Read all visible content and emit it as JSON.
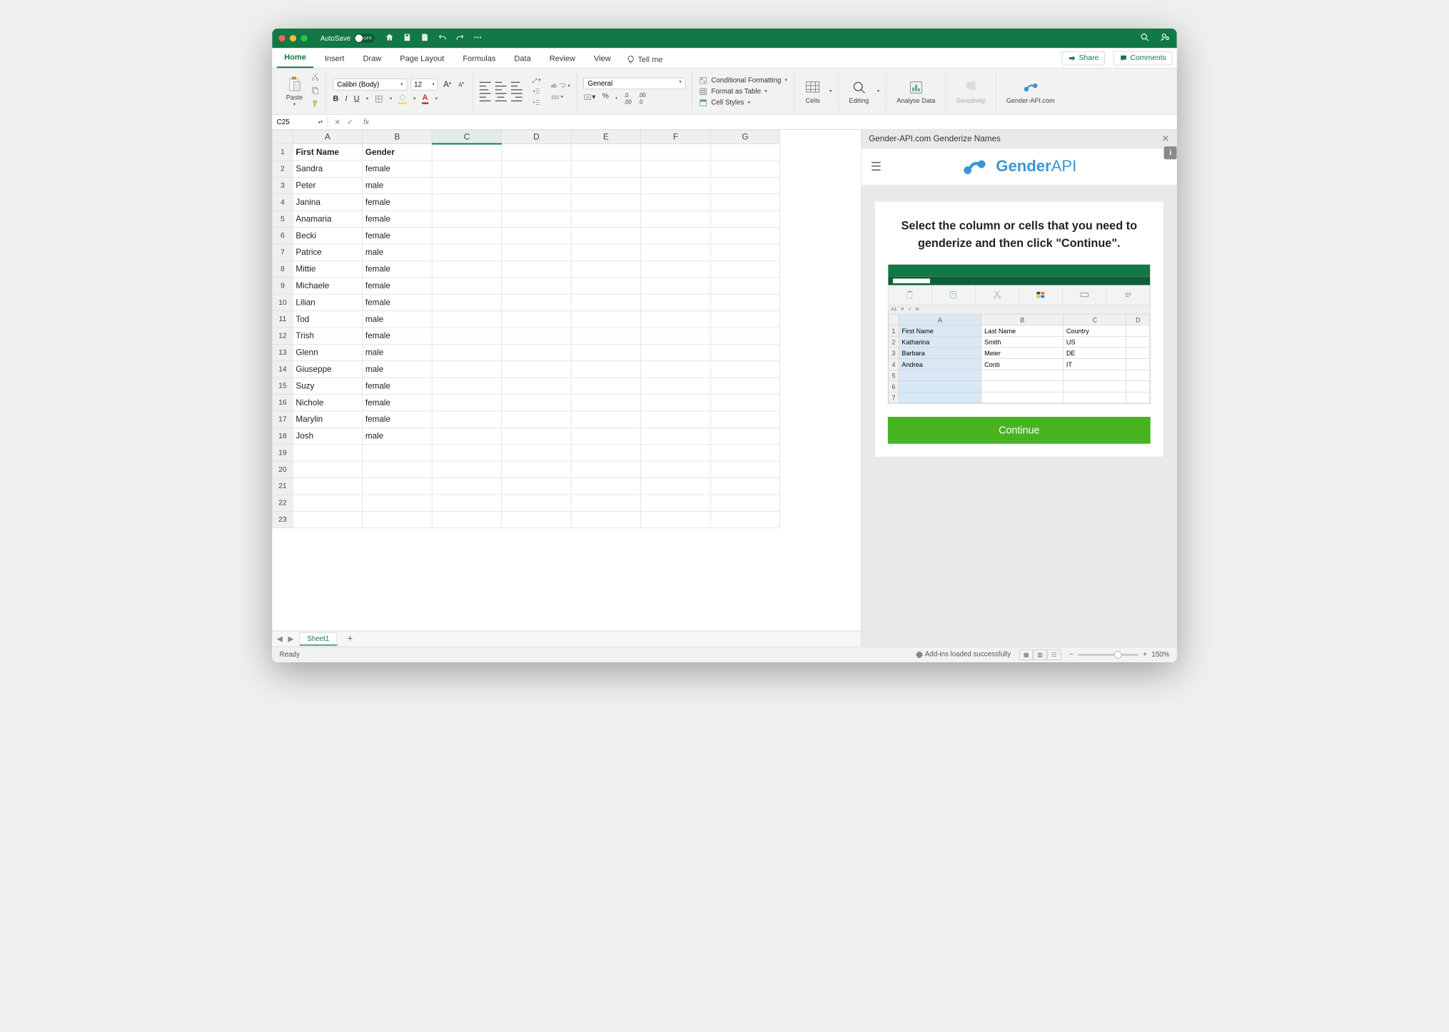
{
  "titlebar": {
    "autosave_label": "AutoSave",
    "autosave_state": "OFF"
  },
  "tabs": {
    "items": [
      "Home",
      "Insert",
      "Draw",
      "Page Layout",
      "Formulas",
      "Data",
      "Review",
      "View"
    ],
    "active": "Home",
    "tellme": "Tell me",
    "share": "Share",
    "comments": "Comments"
  },
  "ribbon": {
    "paste": "Paste",
    "font_name": "Calibri (Body)",
    "font_size": "12",
    "number_format": "General",
    "cond_fmt": "Conditional Formatting",
    "fmt_table": "Format as Table",
    "cell_styles": "Cell Styles",
    "cells": "Cells",
    "editing": "Editing",
    "analyse": "Analyse Data",
    "sensitivity": "Sensitivity",
    "genderapi": "Gender-API.com"
  },
  "formula_bar": {
    "name_box": "C25"
  },
  "sheet": {
    "columns": [
      "A",
      "B",
      "C",
      "D",
      "E",
      "F",
      "G"
    ],
    "selected_col": "C",
    "rows": [
      {
        "n": "1",
        "a": "First Name",
        "b": "Gender"
      },
      {
        "n": "2",
        "a": "Sandra",
        "b": "female"
      },
      {
        "n": "3",
        "a": "Peter",
        "b": "male"
      },
      {
        "n": "4",
        "a": "Janina",
        "b": "female"
      },
      {
        "n": "5",
        "a": "Anamaria",
        "b": "female"
      },
      {
        "n": "6",
        "a": "Becki",
        "b": "female"
      },
      {
        "n": "7",
        "a": "Patrice",
        "b": "male"
      },
      {
        "n": "8",
        "a": "Mittie",
        "b": "female"
      },
      {
        "n": "9",
        "a": "Michaele",
        "b": "female"
      },
      {
        "n": "10",
        "a": "Lilian",
        "b": "female"
      },
      {
        "n": "11",
        "a": "Tod",
        "b": "male"
      },
      {
        "n": "12",
        "a": "Trish",
        "b": "female"
      },
      {
        "n": "13",
        "a": "Glenn",
        "b": "male"
      },
      {
        "n": "14",
        "a": "Giuseppe",
        "b": "male"
      },
      {
        "n": "15",
        "a": "Suzy",
        "b": "female"
      },
      {
        "n": "16",
        "a": "Nichole",
        "b": "female"
      },
      {
        "n": "17",
        "a": "Marylin",
        "b": "female"
      },
      {
        "n": "18",
        "a": "Josh",
        "b": "male"
      },
      {
        "n": "19",
        "a": "",
        "b": ""
      },
      {
        "n": "20",
        "a": "",
        "b": ""
      },
      {
        "n": "21",
        "a": "",
        "b": ""
      },
      {
        "n": "22",
        "a": "",
        "b": ""
      },
      {
        "n": "23",
        "a": "",
        "b": ""
      }
    ],
    "tab_name": "Sheet1"
  },
  "pane": {
    "title": "Gender-API.com Genderize Names",
    "logo_bold": "Gender",
    "logo_light": "API",
    "heading": "Select the column or cells that you need to genderize and then click \"Continue\".",
    "mini_headers": [
      "First Name",
      "Last Name",
      "Country"
    ],
    "mini_cols": [
      "A",
      "B",
      "C",
      "D"
    ],
    "mini_rows": [
      {
        "n": "1",
        "a": "First Name",
        "b": "Last Name",
        "c": "Country"
      },
      {
        "n": "2",
        "a": "Katharina",
        "b": "Smith",
        "c": "US"
      },
      {
        "n": "3",
        "a": "Barbara",
        "b": "Meier",
        "c": "DE"
      },
      {
        "n": "4",
        "a": "Andrea",
        "b": "Conti",
        "c": "IT"
      },
      {
        "n": "5",
        "a": "",
        "b": "",
        "c": ""
      },
      {
        "n": "6",
        "a": "",
        "b": "",
        "c": ""
      },
      {
        "n": "7",
        "a": "",
        "b": "",
        "c": ""
      }
    ],
    "continue": "Continue",
    "namebox": "A1"
  },
  "status": {
    "ready": "Ready",
    "addins": "Add-ins loaded successfully",
    "zoom": "150%"
  }
}
